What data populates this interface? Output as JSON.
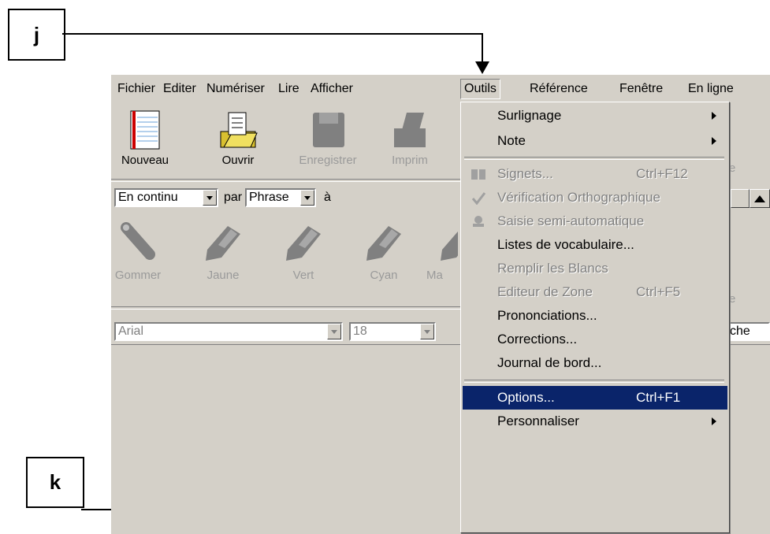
{
  "callouts": {
    "j": "j",
    "k": "k"
  },
  "menubar": [
    "Fichier",
    "Editer",
    "Numériser",
    "Lire",
    "Afficher",
    "Outils",
    "Référence",
    "Fenêtre",
    "En ligne"
  ],
  "toolbar1": [
    {
      "label": "Nouveau",
      "icon": "notebook-icon",
      "enabled": true
    },
    {
      "label": "Ouvrir",
      "icon": "open-folder-icon",
      "enabled": true
    },
    {
      "label": "Enregistrer",
      "icon": "floppy-disk-icon",
      "enabled": false
    },
    {
      "label": "Imprim",
      "icon": "printer-icon",
      "enabled": false
    }
  ],
  "toolbar2": {
    "mode_value": "En continu",
    "par_label": "par",
    "unit_value": "Phrase",
    "a_label": "à"
  },
  "toolbar3": [
    "Gommer",
    "Jaune",
    "Vert",
    "Cyan",
    "Ma"
  ],
  "fontbar": {
    "font": "Arial",
    "size": "18",
    "right_fragment": "che"
  },
  "partial_right_labels": [
    "e",
    "e"
  ],
  "dropdown": {
    "items": [
      {
        "label": "Surlignage",
        "mnemonic": "S",
        "submenu": true
      },
      {
        "label": "Note",
        "mnemonic": "N",
        "submenu": true
      },
      {
        "label": "Signets...",
        "shortcut": "Ctrl+F12",
        "disabled": true,
        "icon": "book-icon"
      },
      {
        "label": "Vérification Orthographique",
        "disabled": true,
        "icon": "spellcheck-icon"
      },
      {
        "label": "Saisie semi-automatique",
        "disabled": true,
        "icon": "autocomplete-icon"
      },
      {
        "label": "Listes de vocabulaire..."
      },
      {
        "label": "Remplir les Blancs",
        "disabled": true
      },
      {
        "label": "Editeur de Zone",
        "shortcut": "Ctrl+F5",
        "disabled": true
      },
      {
        "label": "Prononciations..."
      },
      {
        "label": "Corrections..."
      },
      {
        "label": "Journal de bord..."
      },
      {
        "label": "Options...",
        "shortcut": "Ctrl+F1",
        "selected": true
      },
      {
        "label": "Personnaliser",
        "submenu": true
      }
    ]
  },
  "colors": {
    "menu_face": "#d4d0c8",
    "highlight": "#0a246a",
    "disabled_text": "#808080"
  }
}
